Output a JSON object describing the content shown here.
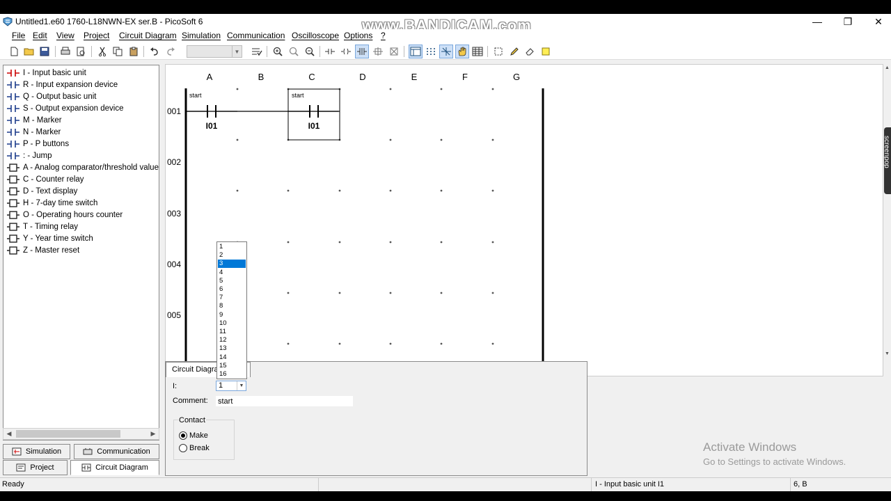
{
  "window": {
    "title": "Untitled1.e60 1760-L18NWN-EX ser.B - PicoSoft 6",
    "watermark": "www.BANDICAM.com",
    "minimize": "—",
    "restore": "❐",
    "close": "✕"
  },
  "menu": [
    "File",
    "Edit",
    "View",
    "Project",
    "Circuit Diagram",
    "Simulation",
    "Communication",
    "Oscilloscope",
    "Options",
    "?"
  ],
  "toolbar": {
    "icons": [
      "new-file-icon",
      "open-folder-icon",
      "save-icon",
      "print-icon",
      "print-preview-icon",
      "cut-icon",
      "copy-icon",
      "paste-icon",
      "undo-icon",
      "redo-icon",
      "zoom-combo",
      "check-icon",
      "zoom-in-icon",
      "zoom-fit-icon",
      "zoom-out-icon",
      "contact-icon",
      "coil-icon",
      "parallel-contact-icon",
      "connection-icon",
      "delete-connection-icon",
      "view-diagram-icon",
      "grid-icon",
      "cross-icon",
      "hand-icon",
      "table-icon",
      "select-icon",
      "pencil-icon",
      "eraser-icon",
      "note-icon"
    ]
  },
  "sidebar": {
    "items": [
      {
        "label": "I - Input basic unit",
        "kind": "contact",
        "color": "#cc0000"
      },
      {
        "label": "R - Input expansion device",
        "kind": "contact",
        "color": "#1a3a8a"
      },
      {
        "label": "Q - Output basic unit",
        "kind": "contact",
        "color": "#1a3a8a"
      },
      {
        "label": "S - Output expansion device",
        "kind": "contact",
        "color": "#1a3a8a"
      },
      {
        "label": "M - Marker",
        "kind": "contact",
        "color": "#1a3a8a"
      },
      {
        "label": "N - Marker",
        "kind": "contact",
        "color": "#1a3a8a"
      },
      {
        "label": "P - P buttons",
        "kind": "contact",
        "color": "#1a3a8a"
      },
      {
        "label": ": - Jump",
        "kind": "contact",
        "color": "#1a3a8a"
      },
      {
        "label": "A - Analog comparator/threshold value",
        "kind": "block",
        "color": "#222222"
      },
      {
        "label": "C - Counter relay",
        "kind": "block",
        "color": "#222222"
      },
      {
        "label": "D - Text display",
        "kind": "block",
        "color": "#222222"
      },
      {
        "label": "H - 7-day time switch",
        "kind": "block",
        "color": "#222222"
      },
      {
        "label": "O - Operating hours counter",
        "kind": "block",
        "color": "#222222"
      },
      {
        "label": "T - Timing relay",
        "kind": "block",
        "color": "#222222"
      },
      {
        "label": "Y - Year time switch",
        "kind": "block",
        "color": "#222222"
      },
      {
        "label": "Z - Master reset",
        "kind": "block",
        "color": "#222222"
      }
    ]
  },
  "bottom_tabs": {
    "simulation": "Simulation",
    "communication": "Communication",
    "project": "Project",
    "circuit_diagram": "Circuit Diagram"
  },
  "diagram": {
    "columns": [
      "A",
      "B",
      "C",
      "D",
      "E",
      "F",
      "G"
    ],
    "rows": [
      "001",
      "002",
      "003",
      "004",
      "005"
    ],
    "contacts": [
      {
        "col": 0,
        "row": 0,
        "name": "I01",
        "comment": "start",
        "selected": false
      },
      {
        "col": 2,
        "row": 0,
        "name": "I01",
        "comment": "start",
        "selected": true
      }
    ]
  },
  "properties": {
    "tab": "Circuit Diagram",
    "i_label": "I:",
    "i_value": "1",
    "comment_label": "Comment:",
    "comment_value": "start",
    "contact_group": "Contact",
    "make": "Make",
    "break": "Break",
    "selected_contact": "make"
  },
  "dropdown": {
    "options": [
      "1",
      "2",
      "3",
      "4",
      "5",
      "6",
      "7",
      "8",
      "9",
      "10",
      "11",
      "12",
      "13",
      "14",
      "15",
      "16"
    ],
    "highlighted": "3"
  },
  "activate": {
    "line1": "Activate Windows",
    "line2": "Go to Settings to activate Windows."
  },
  "status": {
    "left": "Ready",
    "middle": "I - Input basic unit I1",
    "right": "6, B"
  },
  "side_tag": "screenpop"
}
